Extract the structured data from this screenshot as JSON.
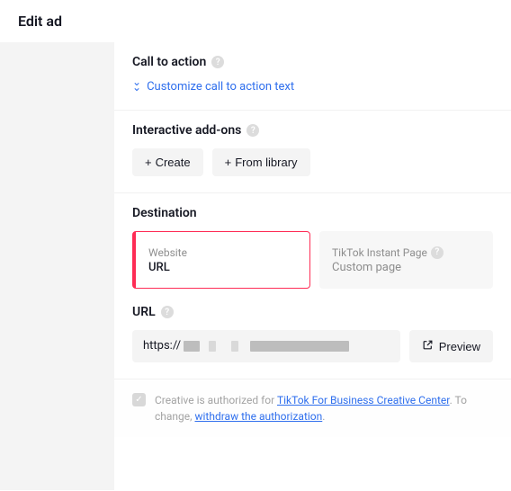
{
  "page_title": "Edit ad",
  "call_to_action": {
    "title": "Call to action",
    "customize_link": "Customize call to action text"
  },
  "interactive_addons": {
    "title": "Interactive add-ons",
    "create_btn": "Create",
    "library_btn": "From library"
  },
  "destination": {
    "title": "Destination",
    "website": {
      "label": "Website",
      "value": "URL"
    },
    "instant_page": {
      "label": "TikTok Instant Page",
      "value": "Custom page"
    }
  },
  "url": {
    "title": "URL",
    "value": "https://",
    "preview_btn": "Preview"
  },
  "footer": {
    "pre": "Creative is authorized for ",
    "link1": "TikTok For Business Creative Center",
    "post": ". To change, ",
    "link2": "withdraw the authorization",
    "period": "."
  }
}
